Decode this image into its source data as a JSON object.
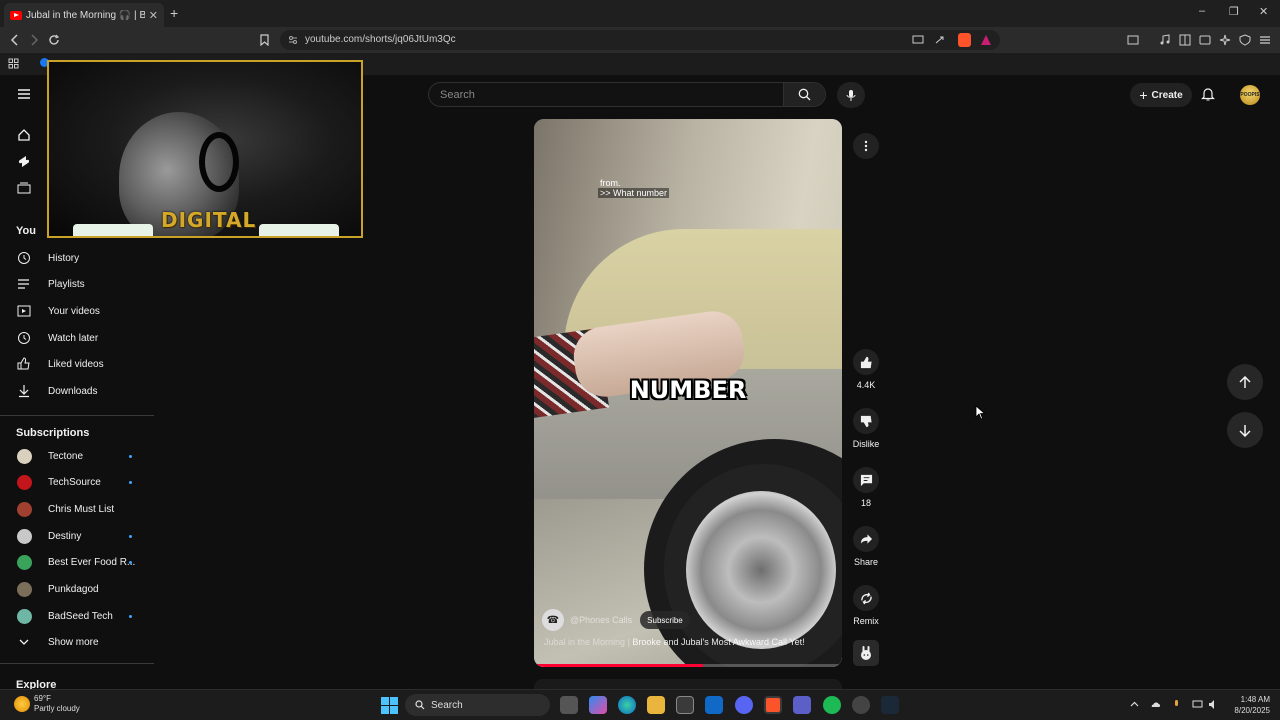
{
  "browser": {
    "tab_title": "Jubal in the Morning 🎧 | Br...",
    "tab_close": "✕",
    "new_tab": "+",
    "url": "youtube.com/shorts/jq06JtUm3Qc",
    "window_controls": {
      "minimize": "–",
      "maximize": "❐",
      "close": "✕"
    }
  },
  "header": {
    "search_placeholder": "Search",
    "create_label": "Create",
    "avatar_text": "POOPIS"
  },
  "sidebar": {
    "you_label": "You",
    "you_items": [
      {
        "label": "History",
        "icon": "history-icon"
      },
      {
        "label": "Playlists",
        "icon": "playlists-icon"
      },
      {
        "label": "Your videos",
        "icon": "your-videos-icon"
      },
      {
        "label": "Watch later",
        "icon": "watch-later-icon"
      },
      {
        "label": "Liked videos",
        "icon": "like-icon"
      },
      {
        "label": "Downloads",
        "icon": "download-icon"
      }
    ],
    "subscriptions_label": "Subscriptions",
    "subscriptions": [
      {
        "label": "Tectone",
        "color": "#d9d0bd"
      },
      {
        "label": "TechSource",
        "color": "#c4151c"
      },
      {
        "label": "Chris Must List",
        "color": "#a04030"
      },
      {
        "label": "Destiny",
        "color": "#c8c8c8"
      },
      {
        "label": "Best Ever Food R...",
        "color": "#3aa35b"
      },
      {
        "label": "Punkdagod",
        "color": "#7b6f5a"
      },
      {
        "label": "BadSeed Tech",
        "color": "#6fb6a4"
      }
    ],
    "show_more": "Show more",
    "explore_label": "Explore"
  },
  "webcam": {
    "logo_text": "DIGITAL"
  },
  "short": {
    "caption_line1": "from.",
    "caption_line2": ">> What number",
    "caption_big": "NUMBER",
    "channel_handle": "@Phones Calls",
    "subscribe_label": "Subscribe",
    "title_channel": "Jubal in the Morning",
    "title_text": "Brooke and Jubal's Most Awkward Call Yet!",
    "progress": 0.55,
    "like_count": "4.4K",
    "dislike_label": "Dislike",
    "comment_count": "18",
    "share_label": "Share",
    "remix_label": "Remix"
  },
  "taskbar": {
    "weather_temp": "69°F",
    "weather_desc": "Partly cloudy",
    "search_label": "Search",
    "time": "1:48 AM",
    "date": "8/20/2025"
  }
}
